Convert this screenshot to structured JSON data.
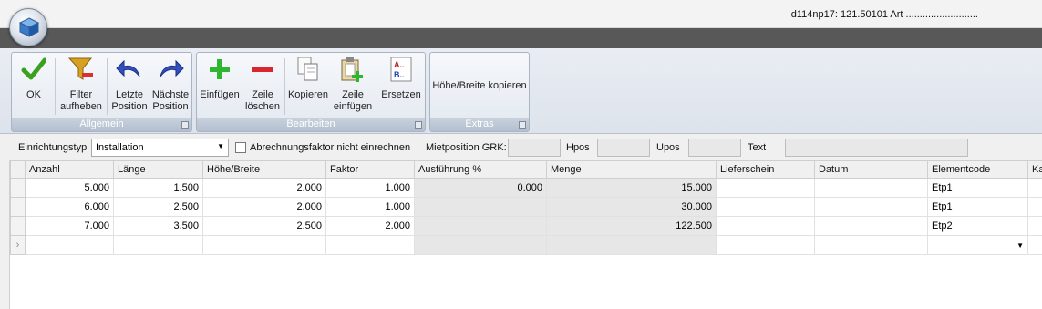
{
  "window": {
    "title": "d114np17: 121.50101 Art .........................."
  },
  "ribbon": {
    "groups": [
      {
        "label": "Allgemein"
      },
      {
        "label": "Bearbeiten"
      },
      {
        "label": "Extras"
      }
    ],
    "buttons": {
      "ok": "OK",
      "filter_1": "Filter",
      "filter_2": "aufheben",
      "prev_1": "Letzte",
      "prev_2": "Position",
      "next_1": "Nächste",
      "next_2": "Position",
      "insert": "Einfügen",
      "delete_1": "Zeile",
      "delete_2": "löschen",
      "copy": "Kopieren",
      "paste_1": "Zeile",
      "paste_2": "einfügen",
      "replace": "Ersetzen",
      "copy_hw": "Höhe/Breite kopieren"
    }
  },
  "filterbar": {
    "type_label": "Einrichtungstyp",
    "type_value": "Installation",
    "factor_checkbox_label": "Abrechnungsfaktor nicht einrechnen",
    "mietposition_label": "Mietposition GRK:",
    "hpos_label": "Hpos",
    "upos_label": "Upos",
    "text_label": "Text"
  },
  "table": {
    "columns": [
      "Anzahl",
      "Länge",
      "Höhe/Breite",
      "Faktor",
      "Ausführung %",
      "Menge",
      "Lieferschein",
      "Datum",
      "Elementcode",
      "Kat"
    ],
    "rows": [
      {
        "anzahl": "5.000",
        "laenge": "1.500",
        "hoehe": "2.000",
        "faktor": "1.000",
        "ausfuehrung": "0.000",
        "menge": "15.000",
        "lieferschein": "",
        "datum": "",
        "code": "Etp1",
        "kat": ""
      },
      {
        "anzahl": "6.000",
        "laenge": "2.500",
        "hoehe": "2.000",
        "faktor": "1.000",
        "ausfuehrung": "",
        "menge": "30.000",
        "lieferschein": "",
        "datum": "",
        "code": "Etp1",
        "kat": ""
      },
      {
        "anzahl": "7.000",
        "laenge": "3.500",
        "hoehe": "2.500",
        "faktor": "2.000",
        "ausfuehrung": "",
        "menge": "122.500",
        "lieferschein": "",
        "datum": "",
        "code": "Etp2",
        "kat": ""
      }
    ],
    "new_row_marker": "›"
  }
}
